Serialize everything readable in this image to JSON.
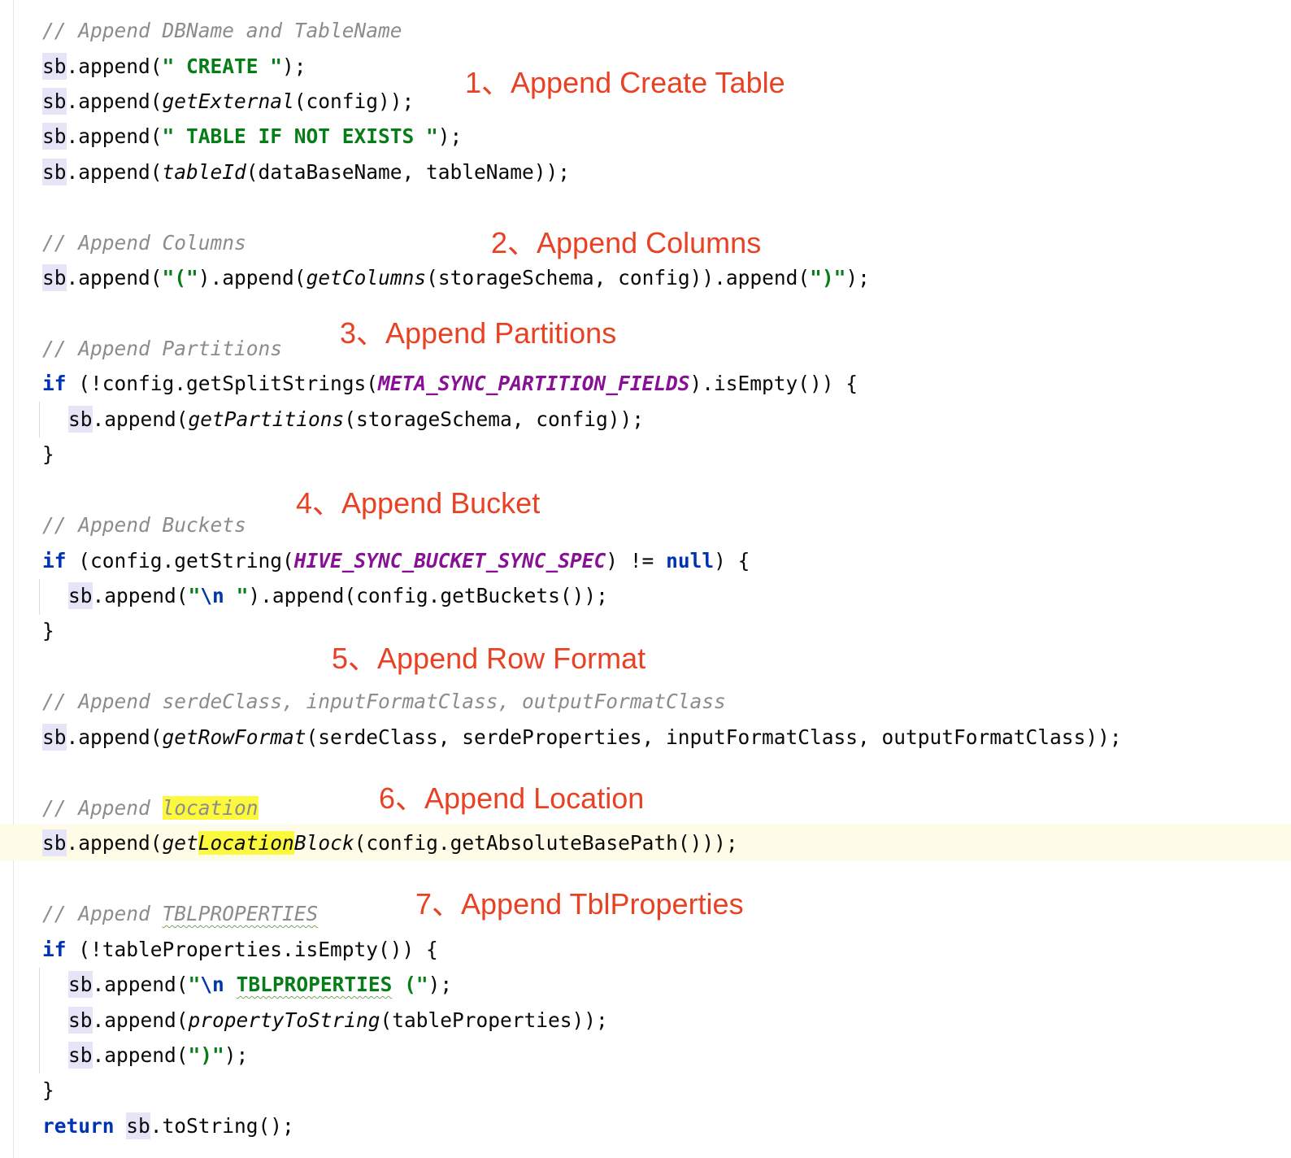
{
  "code": {
    "l1": {
      "comment": "// Append DBName and TableName"
    },
    "l2": {
      "var": "sb",
      "a": ".append(",
      "s": "\" CREATE \"",
      "b": ");"
    },
    "l3": {
      "var": "sb",
      "a": ".append(",
      "m": "getExternal",
      "b": "(config));"
    },
    "l4": {
      "var": "sb",
      "a": ".append(",
      "s": "\" TABLE IF NOT EXISTS \"",
      "b": ");"
    },
    "l5": {
      "var": "sb",
      "a": ".append(",
      "m": "tableId",
      "b": "(dataBaseName, tableName));"
    },
    "l6": {
      "comment": "// Append Columns"
    },
    "l7": {
      "var": "sb",
      "a": ".append(",
      "s1": "\"(\"",
      "b": ").append(",
      "m": "getColumns",
      "c": "(storageSchema, config)).append(",
      "s2": "\")\"",
      "d": ");"
    },
    "l8": {
      "comment": "// Append Partitions"
    },
    "l9": {
      "kw": "if",
      "a": " (!config.getSplitStrings(",
      "const": "META_SYNC_PARTITION_FIELDS",
      "b": ").isEmpty()) {"
    },
    "l10": {
      "var": "sb",
      "a": ".append(",
      "m": "getPartitions",
      "b": "(storageSchema, config));"
    },
    "l11": {
      "text": "}"
    },
    "l12": {
      "comment": "// Append Buckets"
    },
    "l13": {
      "kw": "if",
      "a": " (config.getString(",
      "const": "HIVE_SYNC_BUCKET_SYNC_SPEC",
      "b": ") != ",
      "kw2": "null",
      "c": ") {"
    },
    "l14": {
      "var": "sb",
      "a": ".append(",
      "q1": "\"",
      "esc": "\\n",
      "q2": " \"",
      "b": ").append(config.getBuckets());"
    },
    "l15": {
      "text": "}"
    },
    "l16": {
      "comment": "// Append serdeClass, inputFormatClass, outputFormatClass"
    },
    "l17": {
      "var": "sb",
      "a": ".append(",
      "m": "getRowFormat",
      "b": "(serdeClass, serdeProperties, inputFormatClass, outputFormatClass));"
    },
    "l18": {
      "comment": "// Append ",
      "hl": "location"
    },
    "l19": {
      "var": "sb",
      "a": ".append(",
      "m1": "get",
      "m2": "Location",
      "m3": "Block",
      "b": "(config.getAbsoluteBasePath()));"
    },
    "l20": {
      "comment": "// Append ",
      "sq": "TBLPROPERTIES"
    },
    "l21": {
      "kw": "if",
      "a": " (!tableProperties.isEmpty()) {"
    },
    "l22": {
      "var": "sb",
      "a": ".append(",
      "q1": "\"",
      "esc": "\\n",
      "sp": " ",
      "sq": "TBLPROPERTIES",
      "q2": " (\"",
      "b": ");"
    },
    "l23": {
      "var": "sb",
      "a": ".append(",
      "m": "propertyToString",
      "b": "(tableProperties));"
    },
    "l24": {
      "var": "sb",
      "a": ".append(",
      "s": "\")\"",
      "b": ");"
    },
    "l25": {
      "text": "}"
    },
    "l26": {
      "kw": "return",
      "sp": " ",
      "var": "sb",
      "a": ".toString();"
    }
  },
  "annotations": [
    "1、Append Create Table",
    "2、Append Columns",
    "3、Append Partitions",
    "4、Append Bucket",
    "5、Append Row Format",
    "6、Append Location",
    "7、Append TblProperties"
  ],
  "colors": {
    "annotation": "#e84124",
    "keyword": "#0033b3",
    "string": "#067d17",
    "constant": "#871094",
    "comment": "#8c8c8c",
    "variable_bg": "#e6e4f7",
    "search_highlight": "#fbf83e",
    "caret_row": "#fefbe6"
  }
}
